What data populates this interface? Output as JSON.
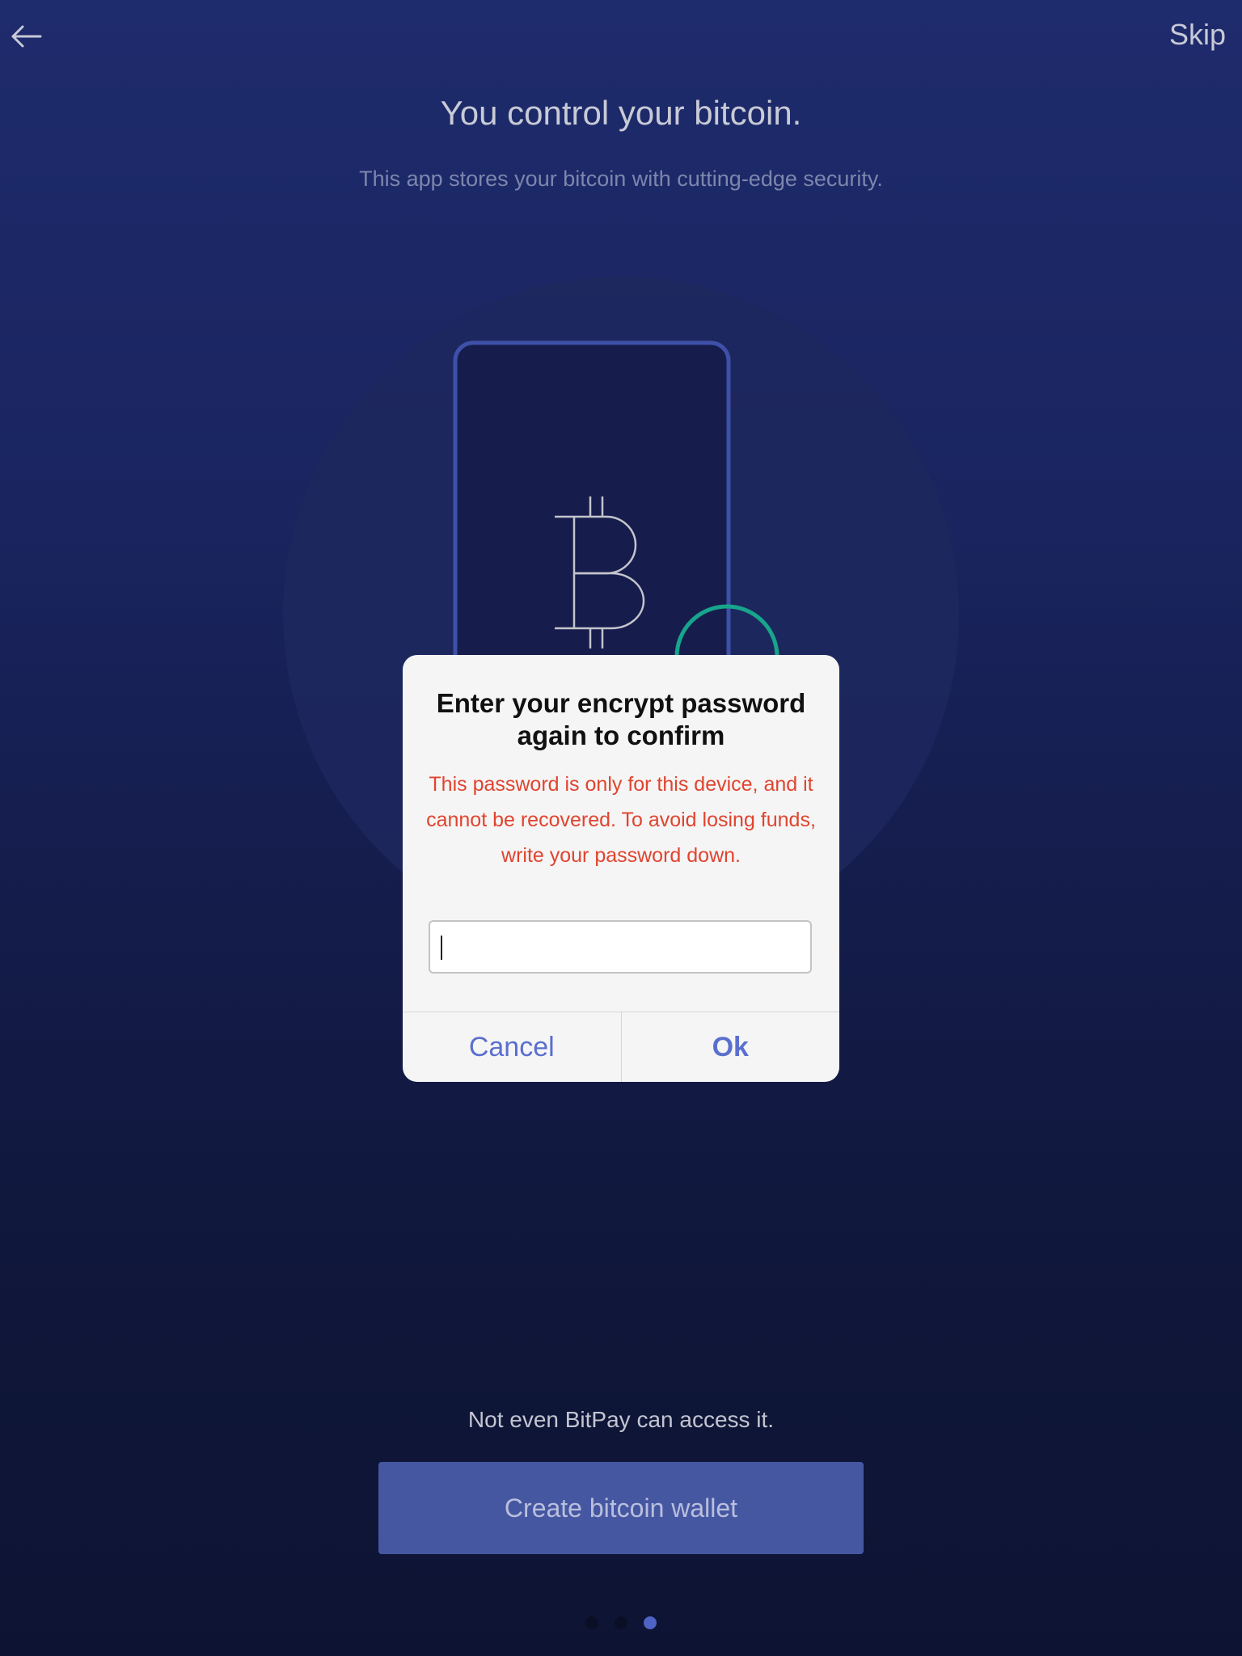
{
  "header": {
    "back_icon": "arrow-left-icon",
    "skip_label": "Skip"
  },
  "onboarding": {
    "title": "You control your bitcoin.",
    "subtitle": "This app stores your bitcoin with cutting-edge security.",
    "illustration_icons": [
      "phone-icon",
      "bitcoin-icon",
      "shield-icon"
    ],
    "bottom_text": "Not even BitPay can access it.",
    "create_wallet_label": "Create bitcoin wallet",
    "pager": {
      "total": 3,
      "active_index": 2
    }
  },
  "dialog": {
    "title": "Enter your encrypt password again to confirm",
    "message": "This password is only for this device, and it cannot be recovered. To avoid losing funds, write your password down.",
    "input_value": "",
    "cancel_label": "Cancel",
    "ok_label": "Ok"
  },
  "colors": {
    "background_top": "#1e2b6c",
    "background_bottom": "#0d1433",
    "accent_blue": "#5a6fcf",
    "primary_button": "#4657a2",
    "warning_red": "#e0442f",
    "green_ring": "#17a58c"
  }
}
